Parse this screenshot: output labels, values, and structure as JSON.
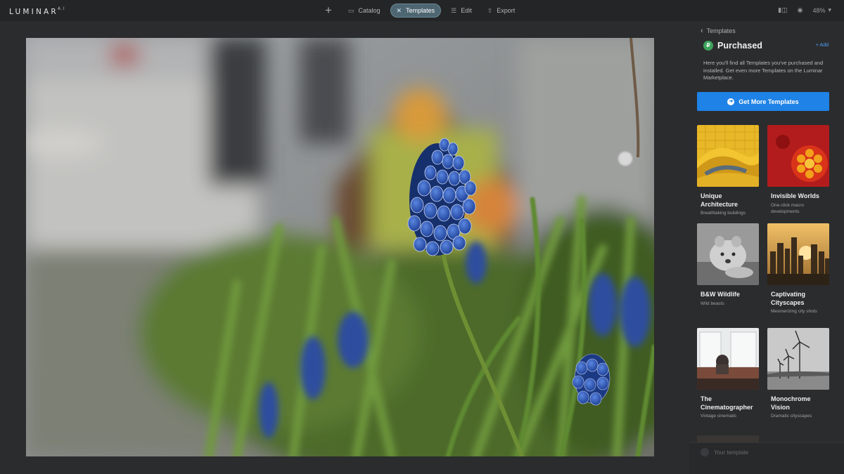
{
  "app": {
    "logo": "LUMINAR",
    "logo_version": "A.I"
  },
  "nav": {
    "items": [
      {
        "label": "Catalog",
        "icon": "folder-icon"
      },
      {
        "label": "Templates",
        "icon": "templates-icon",
        "active": true
      },
      {
        "label": "Edit",
        "icon": "sliders-icon"
      },
      {
        "label": "Export",
        "icon": "export-icon"
      }
    ],
    "zoom": "48%"
  },
  "panel": {
    "back_label": "Templates",
    "title": "Purchased",
    "add_label": "+ Add",
    "description": "Here you'll find all Templates you've purchased and installed. Get even more Templates on the Luminar Marketplace.",
    "get_more_label": "Get More Templates",
    "cards": [
      {
        "name": "Unique Architecture",
        "sub": "Breathtaking buildings"
      },
      {
        "name": "Invisible Worlds",
        "sub": "One-click macro developments"
      },
      {
        "name": "B&W Wildlife",
        "sub": "Wild beasts"
      },
      {
        "name": "Captivating Cityscapes",
        "sub": "Mesmerizing city shots"
      },
      {
        "name": "The Cinematographer",
        "sub": "Vintage cinematic"
      },
      {
        "name": "Monochrome Vision",
        "sub": "Dramatic cityscapes"
      }
    ],
    "your_template_label": "Your template"
  },
  "colors": {
    "accent": "#1e82e6",
    "active_tab": "#4d6672",
    "badge": "#3ea35c"
  }
}
